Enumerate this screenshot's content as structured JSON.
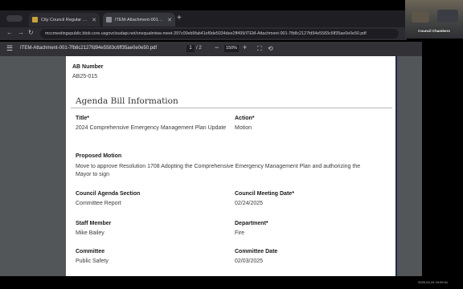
{
  "browser": {
    "tabs": [
      {
        "title": "City Council Regular Meeting",
        "favicon_color": "#c8a23c"
      },
      {
        "title": "ITEM-Attachment-001-7fb8c...",
        "favicon_color": "#8c8c94"
      }
    ],
    "new_tab": "+",
    "address_url": "mccmeetingspublic.blob.core.usgovcloudapi.net/snoqualmiwa-meet-397c00eb9fab41ef9de5034dee2ff499/ITEM-Attachment-001-7fb8c2127fd94e5583c6ff35ae0e0e50.pdf"
  },
  "pdf_toolbar": {
    "file_name": "ITEM-Attachment-001-7fb8c2127fd94e5583c6ff35ae0e0e50.pdf",
    "current_page": "1",
    "page_sep": "/ 2",
    "zoom": "150%"
  },
  "document": {
    "ab_number_label": "AB Number",
    "ab_number_value": "AB25-015",
    "section_title": "Agenda Bill Information",
    "title_label": "Title",
    "title_value": "2024 Comprehensive Emergency Management Plan Update",
    "action_label": "Action",
    "action_value": "Motion",
    "proposed_motion_label": "Proposed Motion",
    "proposed_motion_value": "Move to approve Resolution 1708 Adopting the Comprehensive Emergency Management Plan and authorizing the Mayor to sign",
    "council_agenda_section_label": "Council Agenda Section",
    "council_agenda_section_value": "Committee Report",
    "council_meeting_date_label": "Council Meeting Date",
    "council_meeting_date_value": "02/24/2025",
    "staff_member_label": "Staff Member",
    "staff_member_value": "Mike Bailey",
    "department_label": "Department",
    "department_value": "Fire",
    "committee_label": "Committee",
    "committee_value": "Public Safety",
    "committee_date_label": "Committee Date",
    "committee_date_value": "02/03/2025",
    "required_mark": "*"
  },
  "camera": {
    "label": "Council Chambers"
  },
  "timestamp": "2025-02-24 19:09:41",
  "colors": {
    "page_border": "#1e2a4a",
    "viewer_bg": "#525659",
    "toolbar_bg": "#323236"
  }
}
